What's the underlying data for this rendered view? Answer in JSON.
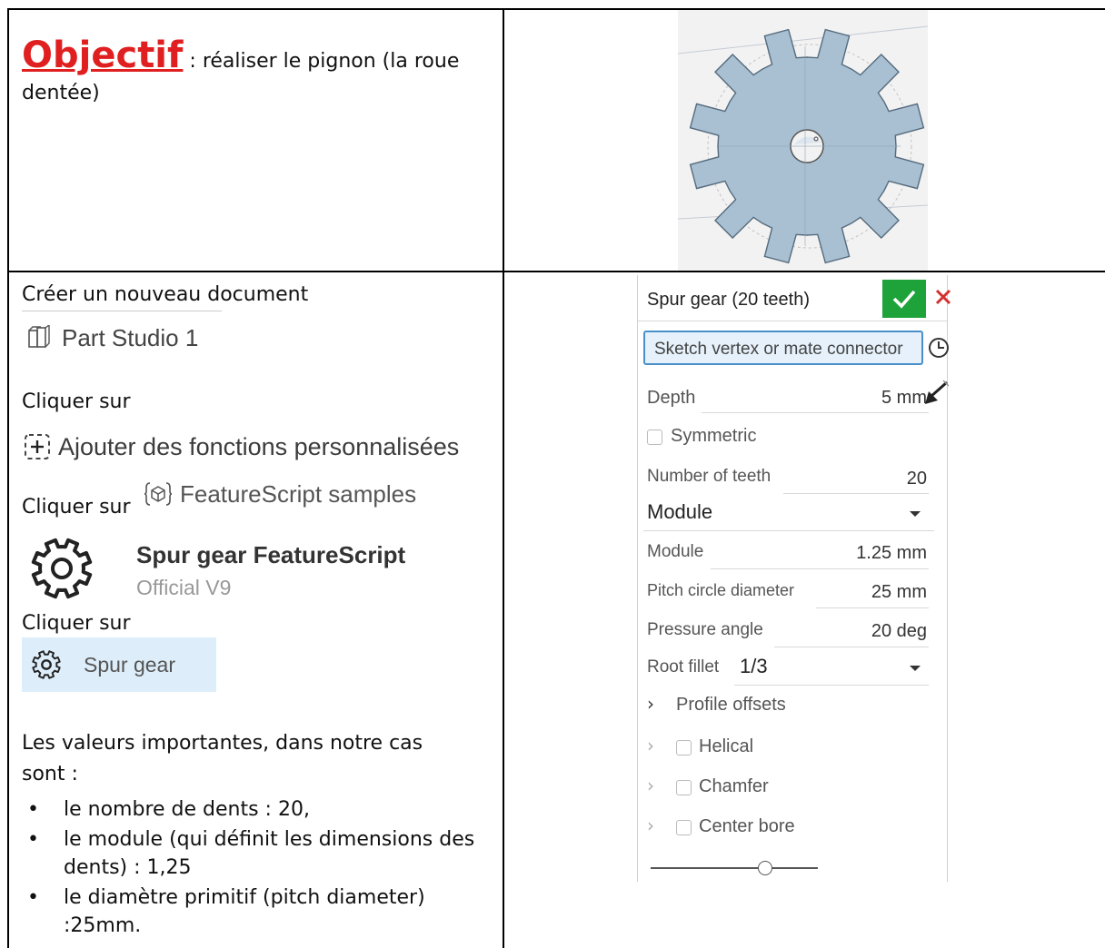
{
  "cell1": {
    "objectif": "Objectif",
    "objectif_rest": " : réaliser le pignon (la roue",
    "objectif_line2": "dentée)"
  },
  "steps": {
    "create_doc": "Créer un nouveau document",
    "part_studio": "Part Studio 1",
    "click1": "Cliquer sur",
    "add_functions": "Ajouter des fonctions personnalisées",
    "click2": "Cliquer sur",
    "featurescript_samples": "FeatureScript samples",
    "spur_title": "Spur gear FeatureScript",
    "spur_sub": "Official V9",
    "click3": "Cliquer sur",
    "spur_gear": "Spur gear",
    "values_intro_1": "Les valeurs importantes, dans notre cas",
    "values_intro_2": "sont :",
    "bullets": [
      "le nombre de dents : 20,",
      "le module (qui définit les dimensions des dents) : 1,25",
      "le diamètre primitif (pitch diameter) :25mm."
    ]
  },
  "panel": {
    "title": "Spur gear (20 teeth)",
    "confirm_icon": "check-icon",
    "cancel_icon": "close-icon",
    "vertex_placeholder": "Sketch vertex or mate connector",
    "depth_label": "Depth",
    "depth_value": "5 mm",
    "symmetric_label": "Symmetric",
    "teeth_label": "Number of teeth",
    "teeth_value": "20",
    "mode_select": "Module",
    "module_label": "Module",
    "module_value": "1.25 mm",
    "pitch_label": "Pitch circle diameter",
    "pitch_value": "25 mm",
    "pressure_label": "Pressure angle",
    "pressure_value": "20 deg",
    "root_fillet_label": "Root fillet",
    "root_fillet_value": "1/3",
    "profile_offsets": "Profile offsets",
    "helical": "Helical",
    "chamfer": "Chamfer",
    "center_bore": "Center bore",
    "colors": {
      "confirm_bg": "#1ea33a",
      "cancel": "#d32f2f",
      "accent": "#4a90c8",
      "gear_fill": "#a9c0d2"
    }
  }
}
